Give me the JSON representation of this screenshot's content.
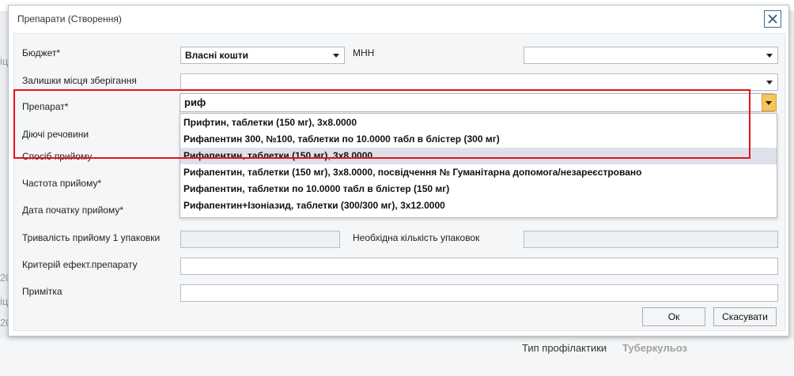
{
  "background": {
    "bottom_label": "Тип профілактики",
    "bottom_value": "Туберкульоз",
    "frag_1": "іці",
    "frag_2": "20",
    "frag_3": "іці",
    "frag_4": "20"
  },
  "modal": {
    "title": "Препарати (Створення)",
    "close_icon": "close-icon"
  },
  "form": {
    "budget_label": "Бюджет*",
    "budget_value": "Власні кошти",
    "mnn_label": "МНН",
    "mnn_value": "",
    "storage_label": "Залишки місця зберігання",
    "storage_value": "",
    "drug_label": "Препарат*",
    "drug_input_value": "риф",
    "active_substances_label": "Діючі речовини",
    "intake_method_label": "Спосіб прийому",
    "frequency_label": "Частота прийому*",
    "start_date_label": "Дата початку прийому*",
    "duration_label": "Тривалість прийому 1 упаковки",
    "packages_needed_label": "Необхідна кількість упаковок",
    "efficacy_label": "Критерій ефект.препарату",
    "note_label": "Примітка"
  },
  "dropdown_options": [
    "Прифтин, таблетки (150 мг), 3х8.0000",
    "Рифапентин 300, №100, таблетки по 10.0000 табл в блістер (300 мг)",
    "Рифапентин, таблетки (150 мг), 3х8.0000",
    "Рифапентин, таблетки (150 мг), 3х8.0000, посвідчення № Гуманітарна допомога/незареєстровано",
    "Рифапентин, таблетки по 10.0000 табл в блістер (150 мг)",
    "Рифапентин+Ізоніазид, таблетки (300/300 мг), 3х12.0000"
  ],
  "highlighted_option_index": 2,
  "buttons": {
    "ok": "Ок",
    "cancel": "Скасувати"
  },
  "colors": {
    "annotation_frame": "#e8121a",
    "dropdown_button": "#f7c55a",
    "highlight": "#dfe1ea"
  }
}
